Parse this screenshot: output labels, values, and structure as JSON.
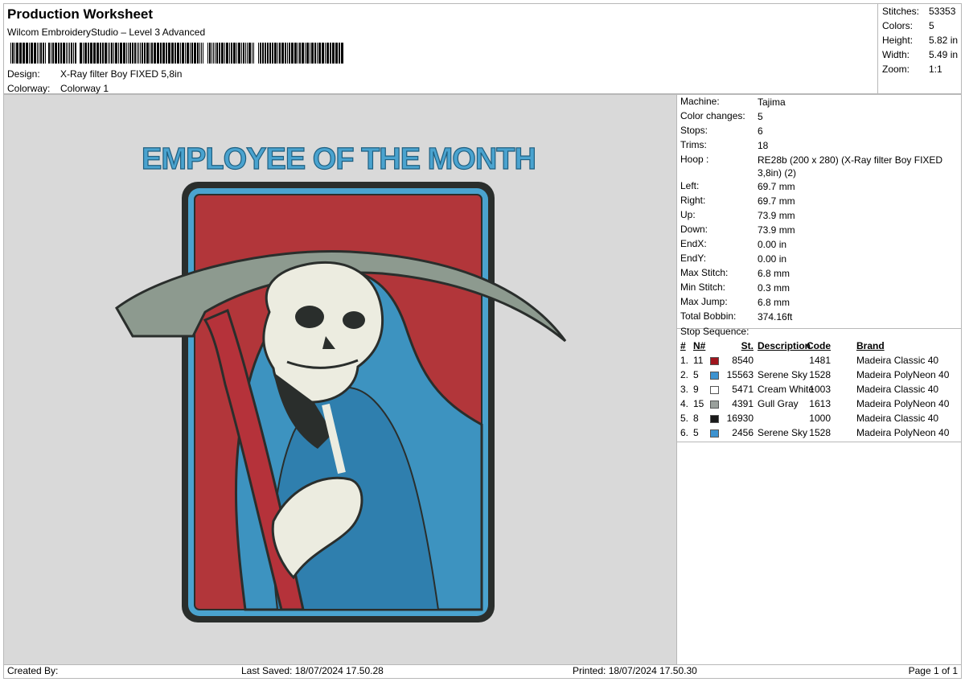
{
  "header": {
    "title": "Production Worksheet",
    "subtitle": "Wilcom EmbroideryStudio – Level 3 Advanced",
    "design_label": "Design:",
    "design_value": "X-Ray filter Boy FIXED 5,8in",
    "colorway_label": "Colorway:",
    "colorway_value": "Colorway 1"
  },
  "stats": [
    {
      "label": "Stitches:",
      "value": "53353"
    },
    {
      "label": "Colors:",
      "value": "5"
    },
    {
      "label": "Height:",
      "value": "5.82 in"
    },
    {
      "label": "Width:",
      "value": "5.49 in"
    },
    {
      "label": "Zoom:",
      "value": "1:1"
    }
  ],
  "design_preview": {
    "headline": "EMPLOYEE OF THE MONTH",
    "colors": {
      "background": "#d9d9d9",
      "frame": "#2a2e2c",
      "border": "#4aa3cf",
      "panel": "#b2363a",
      "robe": "#3d93c0",
      "robe_shadow": "#2f7fae",
      "skull": "#ecece0",
      "scythe": "#8d9a8f",
      "staff": "#b5323a"
    }
  },
  "machine_info": [
    {
      "label": "Machine:",
      "value": "Tajima"
    },
    {
      "label": "Color changes:",
      "value": "5"
    },
    {
      "label": "Stops:",
      "value": "6"
    },
    {
      "label": "Trims:",
      "value": "18"
    },
    {
      "label": "Hoop :",
      "value": "RE28b (200 x 280) (X-Ray filter Boy FIXED 3,8in) (2)"
    },
    {
      "label": "Left:",
      "value": "69.7 mm"
    },
    {
      "label": "Right:",
      "value": "69.7 mm"
    },
    {
      "label": "Up:",
      "value": "73.9 mm"
    },
    {
      "label": "Down:",
      "value": "73.9 mm"
    },
    {
      "label": "EndX:",
      "value": "0.00 in"
    },
    {
      "label": "EndY:",
      "value": "0.00 in"
    },
    {
      "label": "Max Stitch:",
      "value": "6.8 mm"
    },
    {
      "label": "Min Stitch:",
      "value": "0.3 mm"
    },
    {
      "label": "Max Jump:",
      "value": "6.8 mm"
    },
    {
      "label": "Total Bobbin:",
      "value": "374.16ft"
    }
  ],
  "stop_sequence": {
    "title": "Stop Sequence:",
    "headers": {
      "num": "#",
      "n": "N#",
      "st": "St.",
      "description": "Description",
      "code": "Code",
      "brand": "Brand"
    },
    "rows": [
      {
        "num": "1.",
        "n": "11",
        "color": "#a0151e",
        "st": "8540",
        "description": "",
        "code": "1481",
        "brand": "Madeira Classic 40"
      },
      {
        "num": "2.",
        "n": "5",
        "color": "#3d93d0",
        "st": "15563",
        "description": "Serene Sky",
        "code": "1528",
        "brand": "Madeira PolyNeon 40"
      },
      {
        "num": "3.",
        "n": "9",
        "color": "#ffffff",
        "st": "5471",
        "description": "Cream White",
        "code": "1003",
        "brand": "Madeira Classic 40"
      },
      {
        "num": "4.",
        "n": "15",
        "color": "#9aa09c",
        "st": "4391",
        "description": "Gull Gray",
        "code": "1613",
        "brand": "Madeira PolyNeon 40"
      },
      {
        "num": "5.",
        "n": "8",
        "color": "#1a1a1a",
        "st": "16930",
        "description": "",
        "code": "1000",
        "brand": "Madeira Classic 40"
      },
      {
        "num": "6.",
        "n": "5",
        "color": "#3d93d0",
        "st": "2456",
        "description": "Serene Sky",
        "code": "1528",
        "brand": "Madeira PolyNeon 40"
      }
    ]
  },
  "footer": {
    "created_by": "Created By:",
    "last_saved": "Last Saved: 18/07/2024 17.50.28",
    "printed": "Printed: 18/07/2024 17.50.30",
    "page": "Page 1 of 1"
  }
}
